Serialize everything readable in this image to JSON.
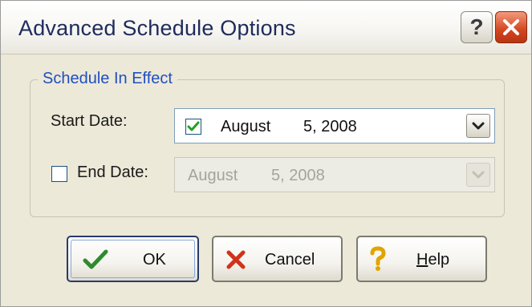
{
  "window": {
    "title": "Advanced Schedule Options"
  },
  "title_buttons": {
    "help": "?",
    "close": "close"
  },
  "group": {
    "label": "Schedule In Effect"
  },
  "start": {
    "label": "Start Date:",
    "checked": true,
    "month": "August",
    "daydate": "5, 2008"
  },
  "end": {
    "label": "End Date:",
    "checked": false,
    "month": "August",
    "daydate": "5, 2008"
  },
  "buttons": {
    "ok": "OK",
    "cancel": "Cancel",
    "help_prefix": "",
    "help_mnemonic": "H",
    "help_rest": "elp"
  },
  "colors": {
    "title_text": "#1e2b5c",
    "group_label": "#1f4fbf",
    "ok_check": "#2e8b2e",
    "cancel_x": "#d0331b",
    "help_question": "#e0a400"
  },
  "icons": [
    "help-icon",
    "close-icon",
    "checkmark-icon",
    "chevron-down-icon",
    "cancel-x-icon",
    "question-mark-icon"
  ]
}
